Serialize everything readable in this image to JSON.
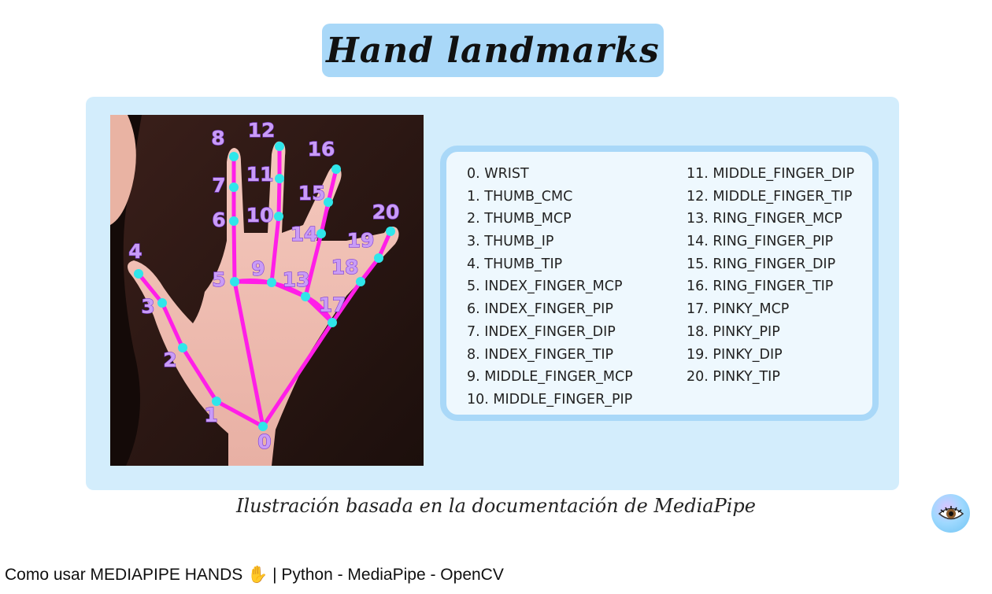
{
  "slide": {
    "title": "Hand landmarks",
    "caption": "Ilustración basada en la documentación de MediaPipe",
    "colors": {
      "title_pill": "#a9d8f8",
      "panel": "#d3edfc",
      "list_border": "#a9d8f8",
      "connection": "#ff1ee8",
      "landmark_point": "#2fe6ea",
      "landmark_number": "#c99cf6"
    }
  },
  "landmarks_left": [
    "0. WRIST",
    "1. THUMB_CMC",
    "2. THUMB_MCP",
    "3. THUMB_IP",
    "4. THUMB_TIP",
    "5. INDEX_FINGER_MCP",
    "6. INDEX_FINGER_PIP",
    "7. INDEX_FINGER_DIP",
    "8. INDEX_FINGER_TIP",
    "9. MIDDLE_FINGER_MCP",
    "10. MIDDLE_FINGER_PIP"
  ],
  "landmarks_right": [
    "11. MIDDLE_FINGER_DIP",
    "12. MIDDLE_FINGER_TIP",
    "13. RING_FINGER_MCP",
    "14. RING_FINGER_PIP",
    "15. RING_FINGER_DIP",
    "16. RING_FINGER_TIP",
    "17. PINKY_MCP",
    "18. PINKY_PIP",
    "19. PINKY_DIP",
    "20. PINKY_TIP"
  ],
  "hand_numbers": [
    "0",
    "1",
    "2",
    "3",
    "4",
    "5",
    "6",
    "7",
    "8",
    "9",
    "10",
    "11",
    "12",
    "13",
    "14",
    "15",
    "16",
    "17",
    "18",
    "19",
    "20"
  ],
  "channel": {
    "avatar_icon": "eye-icon"
  },
  "video": {
    "title_before": "Como usar MEDIAPIPE HANDS ",
    "emoji": "✋",
    "title_after": " | Python - MediaPipe - OpenCV"
  }
}
